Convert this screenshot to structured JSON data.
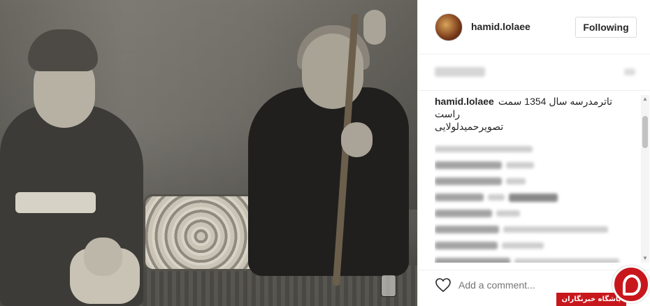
{
  "header": {
    "username": "hamid.lolaee",
    "follow_label": "Following"
  },
  "caption": {
    "username": "hamid.lolaee",
    "line1": "تاترمدرسه سال 1354 سمت راست",
    "line2": "تصویرحمیدلولایی"
  },
  "comment_box": {
    "placeholder": "Add a comment..."
  },
  "watermark": {
    "text": "باشگاه خبرنگاران"
  },
  "icons": {
    "heart": "heart-outline-icon",
    "scroll_up": "scroll-up-arrow-icon",
    "scroll_down": "scroll-down-arrow-icon"
  },
  "colors": {
    "watermark_red": "#c8171c",
    "border": "#efefef",
    "text": "#262626"
  }
}
